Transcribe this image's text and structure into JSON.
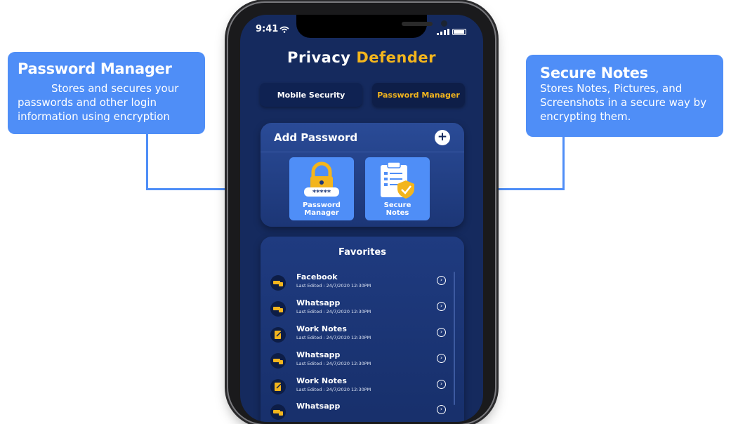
{
  "callouts": {
    "left": {
      "title": "Password Manager",
      "body": "Stores and secures your passwords and other login information using encryption"
    },
    "right": {
      "title": "Secure Notes",
      "body": "Stores Notes, Pictures, and Screenshots in a secure way by encrypting them."
    }
  },
  "status": {
    "time": "9:41"
  },
  "brand": {
    "part1": "Privacy",
    "part2": "Defender"
  },
  "tabs": [
    "Mobile Security",
    "Password Manager"
  ],
  "add_card": {
    "title": "Add Password",
    "add_icon": "+",
    "tiles": [
      {
        "line1": "Password",
        "line2": "Manager",
        "icon": "lock-icon"
      },
      {
        "line1": "Secure",
        "line2": "Notes",
        "icon": "notes-shield-icon"
      }
    ]
  },
  "favorites": {
    "title": "Favorites",
    "items": [
      {
        "name": "Facebook",
        "edited": "Last Edited : 24/7/2020  12:30PM",
        "icon": "key-icon"
      },
      {
        "name": "Whatsapp",
        "edited": "Last Edited : 24/7/2020  12:30PM",
        "icon": "key-icon"
      },
      {
        "name": "Work Notes",
        "edited": "Last Edited : 24/7/2020  12:30PM",
        "icon": "note-icon"
      },
      {
        "name": "Whatsapp",
        "edited": "Last Edited : 24/7/2020  12:30PM",
        "icon": "key-icon"
      },
      {
        "name": "Work Notes",
        "edited": "Last Edited : 24/7/2020  12:30PM",
        "icon": "note-icon"
      },
      {
        "name": "Whatsapp",
        "edited": "",
        "icon": "key-icon"
      }
    ]
  },
  "colors": {
    "accent": "#4f8ef7",
    "brand_yellow": "#f3b51d",
    "screen_bg": "#152a5e"
  }
}
